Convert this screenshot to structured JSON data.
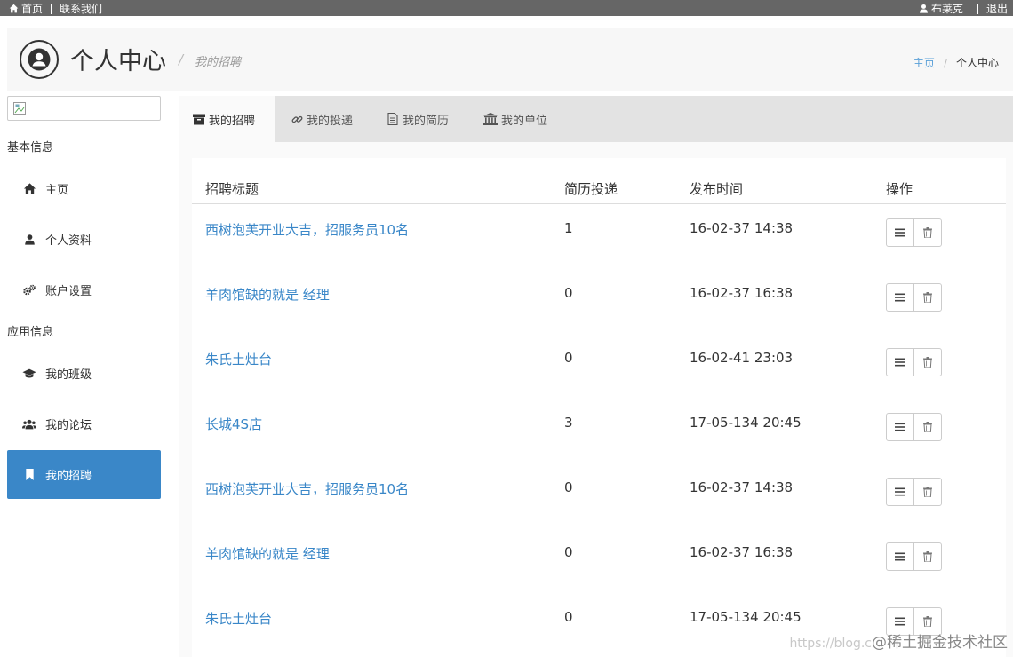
{
  "topbar": {
    "home_label": "首页",
    "contact_label": "联系我们",
    "user_name": "布莱克",
    "logout_label": "退出"
  },
  "header": {
    "title": "个人中心",
    "subtitle": "我的招聘",
    "breadcrumb_home": "主页",
    "breadcrumb_current": "个人中心"
  },
  "sidebar": {
    "section_basic": "基本信息",
    "section_app": "应用信息",
    "items": [
      {
        "label": "主页",
        "icon": "home-icon"
      },
      {
        "label": "个人资料",
        "icon": "user-icon"
      },
      {
        "label": "账户设置",
        "icon": "gears-icon"
      },
      {
        "label": "我的班级",
        "icon": "graduation-cap-icon"
      },
      {
        "label": "我的论坛",
        "icon": "users-icon"
      },
      {
        "label": "我的招聘",
        "icon": "bookmark-icon",
        "active": true
      }
    ]
  },
  "tabs": [
    {
      "label": "我的招聘",
      "icon": "archive-icon",
      "active": true
    },
    {
      "label": "我的投递",
      "icon": "link-icon"
    },
    {
      "label": "我的简历",
      "icon": "file-text-icon"
    },
    {
      "label": "我的单位",
      "icon": "institution-icon"
    }
  ],
  "table": {
    "headers": [
      "招聘标题",
      "简历投递",
      "发布时间",
      "操作"
    ],
    "rows": [
      {
        "title": "西树泡芙开业大吉，招服务员10名",
        "count": "1",
        "time": "16-02-37 14:38"
      },
      {
        "title": "羊肉馆缺的就是 经理",
        "count": "0",
        "time": "16-02-37 16:38"
      },
      {
        "title": "朱氏土灶台",
        "count": "0",
        "time": "16-02-41 23:03"
      },
      {
        "title": "长城4S店",
        "count": "3",
        "time": "17-05-134 20:45"
      },
      {
        "title": "西树泡芙开业大吉，招服务员10名",
        "count": "0",
        "time": "16-02-37 14:38"
      },
      {
        "title": "羊肉馆缺的就是 经理",
        "count": "0",
        "time": "16-02-37 16:38"
      },
      {
        "title": "朱氏土灶台",
        "count": "0",
        "time": "17-05-134 20:45"
      }
    ]
  },
  "watermark": {
    "url_text": "https://blog.c",
    "brand_text": "@稀土掘金技术社区"
  },
  "colors": {
    "topbar_bg": "#666666",
    "accent": "#3a87c8",
    "link": "#3a87c8",
    "tabs_bg": "#e3e3e3"
  }
}
